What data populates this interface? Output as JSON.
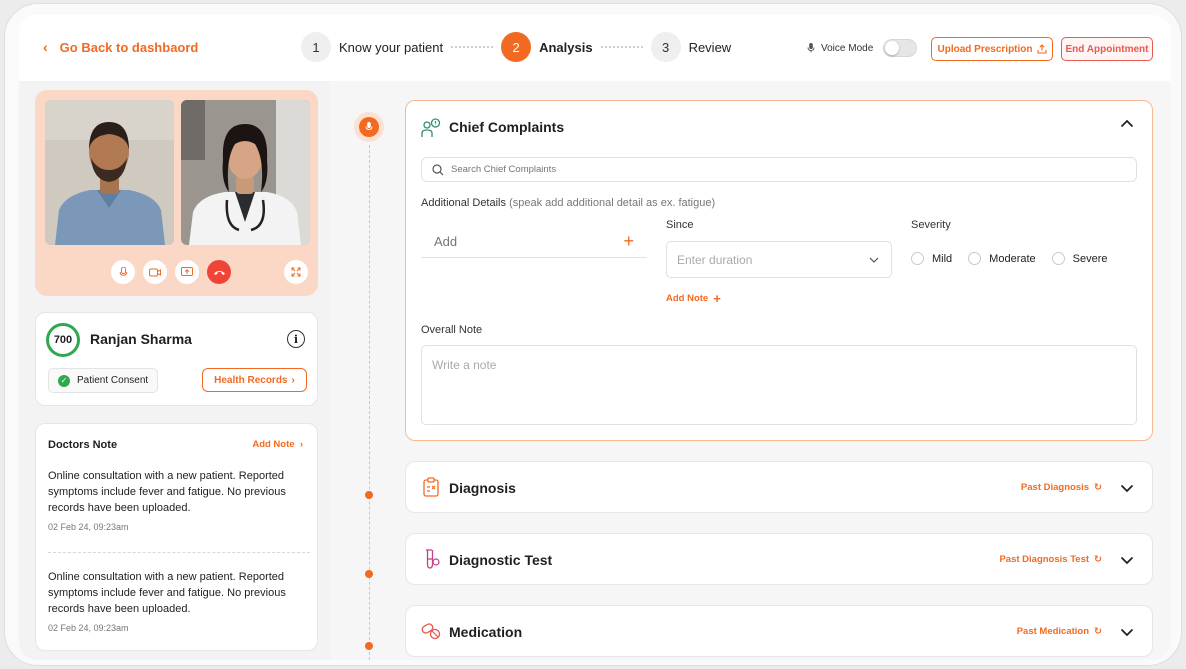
{
  "header": {
    "back_label": "Go Back to dashbaord",
    "steps": [
      {
        "num": "1",
        "label": "Know your patient"
      },
      {
        "num": "2",
        "label": "Analysis"
      },
      {
        "num": "3",
        "label": "Review"
      }
    ],
    "active_step": 2,
    "voice_mode_label": "Voice Mode",
    "voice_mode_on": false,
    "upload_label": "Upload Prescription",
    "end_label": "End Appointment"
  },
  "patient": {
    "score": "700",
    "name": "Ranjan Sharma",
    "consent_label": "Patient Consent",
    "health_records_label": "Health Records"
  },
  "doctors_note": {
    "title": "Doctors Note",
    "add_label": "Add Note",
    "notes": [
      {
        "text": "Online consultation with a new patient. Reported symptoms include fever and fatigue. No previous records have been uploaded.",
        "time": "02 Feb 24, 09:23am"
      },
      {
        "text": "Online consultation with a new patient. Reported symptoms include fever and fatigue. No previous records have been uploaded.",
        "time": "02 Feb 24, 09:23am"
      }
    ]
  },
  "chief_complaints": {
    "title": "Chief Complaints",
    "search_placeholder": "Search Chief Complaints",
    "additional_label": "Additional Details",
    "additional_hint": "(speak add additional detail as ex. fatigue)",
    "add_placeholder": "Add",
    "since_label": "Since",
    "since_placeholder": "Enter duration",
    "severity_label": "Severity",
    "severity_options": [
      "Mild",
      "Moderate",
      "Severe"
    ],
    "add_note_label": "Add Note",
    "overall_label": "Overall Note",
    "overall_placeholder": "Write a note"
  },
  "sections": [
    {
      "title": "Diagnosis",
      "past_label": "Past Diagnosis"
    },
    {
      "title": "Diagnostic Test",
      "past_label": "Past Diagnosis Test"
    },
    {
      "title": "Medication",
      "past_label": "Past Medication"
    }
  ],
  "colors": {
    "accent": "#f26a22",
    "danger": "#ef4438",
    "success": "#2fa84f"
  }
}
